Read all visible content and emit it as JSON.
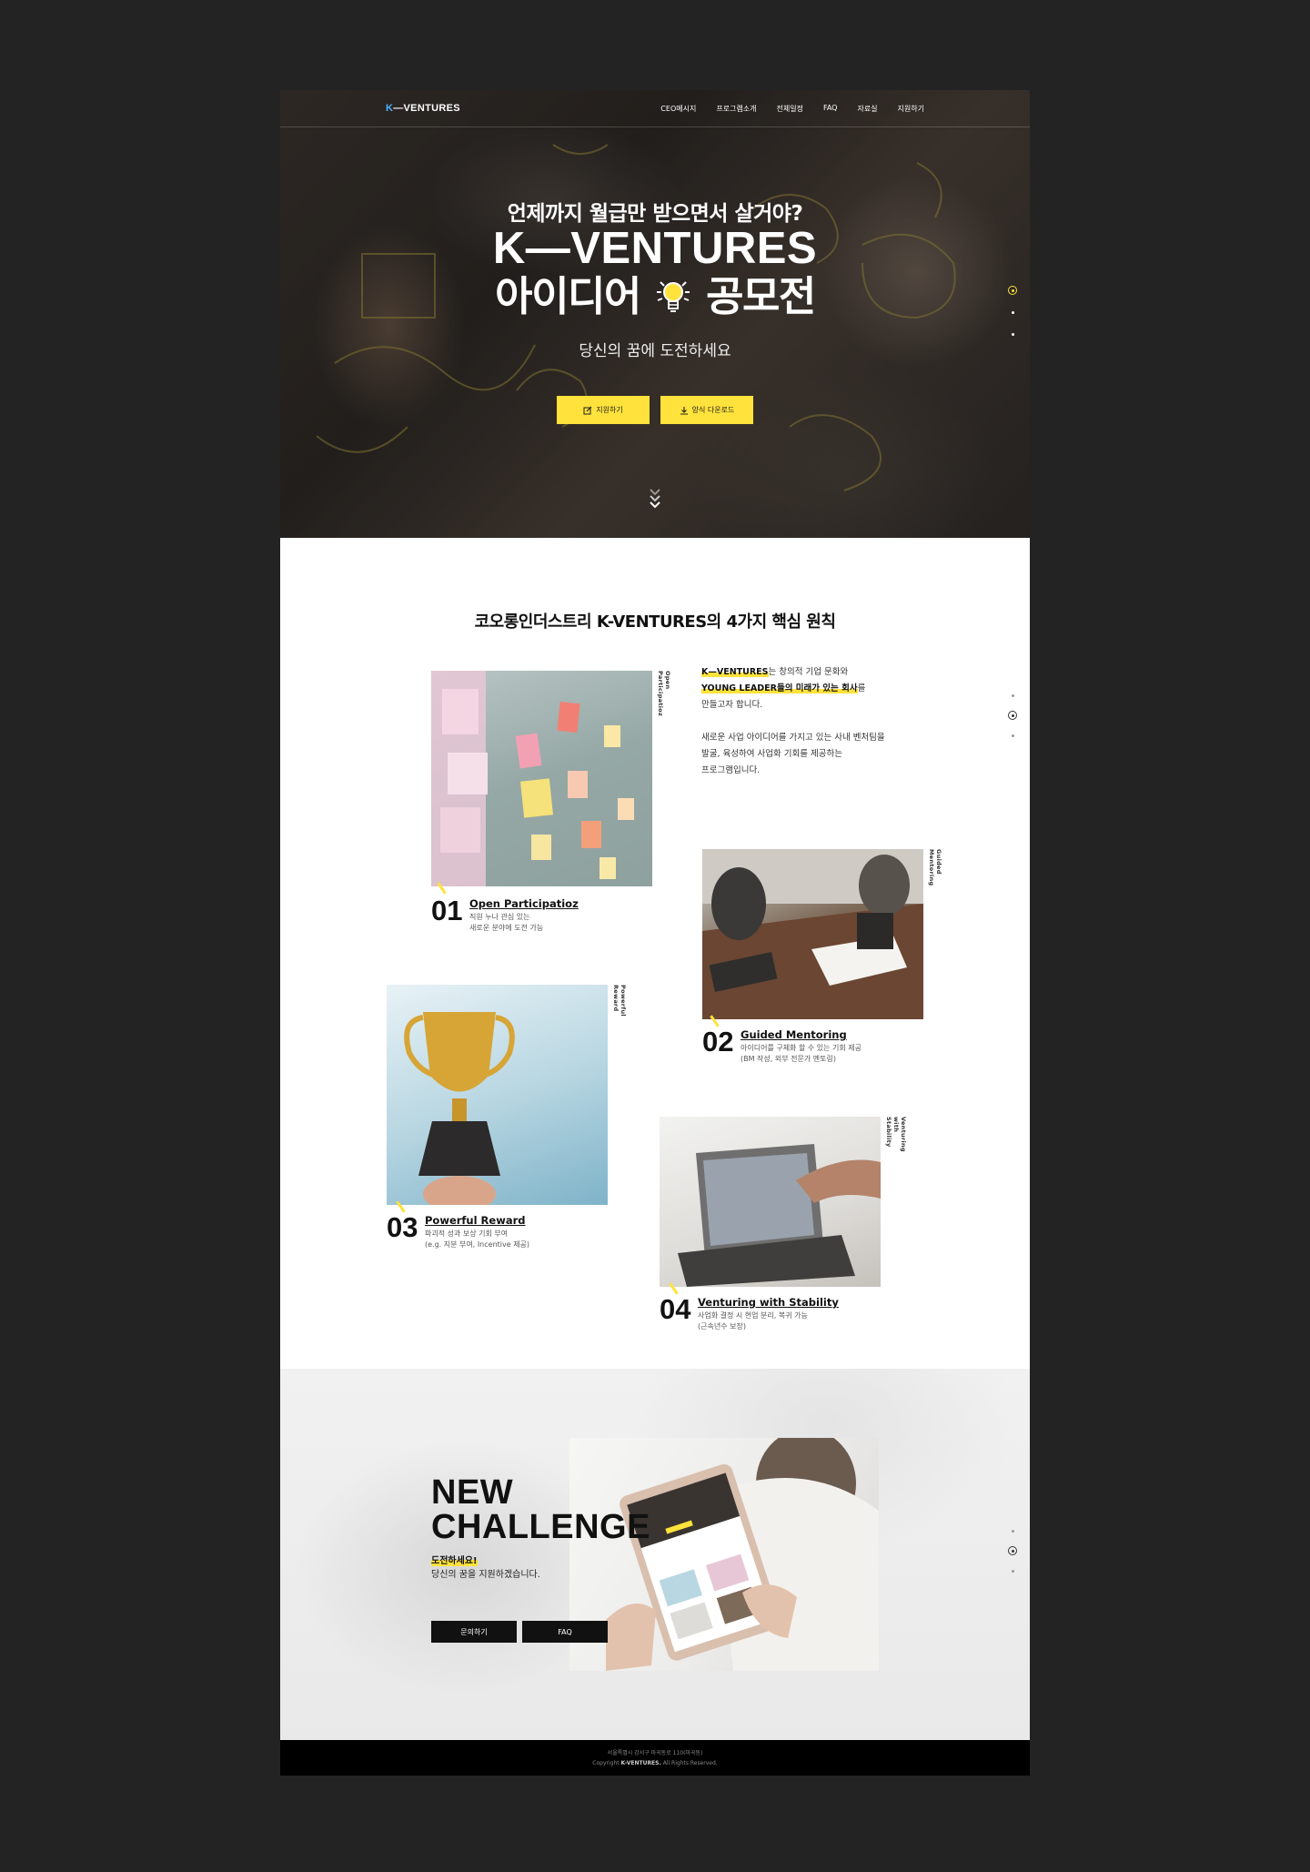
{
  "nav": {
    "logo_k": "K",
    "logo_rest": "—VENTURES",
    "items": [
      "CEO메시지",
      "프로그램소개",
      "전체일정",
      "FAQ",
      "자료실",
      "지원하기"
    ]
  },
  "hero": {
    "tagline": "언제까지 월급만 받으면서 살거야?",
    "brand": "K—VENTURES",
    "contest_left": "아이디어",
    "contest_right": "공모전",
    "subline": "당신의 꿈에 도전하세요",
    "apply_label": "지원하기",
    "download_label": "양식 다운로드"
  },
  "principles": {
    "title": "코오롱인더스트리 K-VENTURES의 4가지 핵심 원칙",
    "intro": {
      "brand": "K—VENTURES",
      "line1_rest": "는 창의적 기업 문화와",
      "line2_hl": "YOUNG LEADER들의 미래가 있는 회사",
      "line2_rest": "를",
      "line3": "만들고자 합니다.",
      "para2": "새로운 사업 아이디어를 가지고 있는 사내 벤처팀을\n발굴, 육성하여 사업화 기회를 제공하는\n프로그램입니다."
    },
    "cards": [
      {
        "num": "01",
        "name": "Open Participatioz",
        "vertical": "Open Participatioz",
        "desc1": "직원 누나 관심 있는",
        "desc2": "새로운 분야에 도전 가능"
      },
      {
        "num": "02",
        "name": "Guided Mentoring",
        "vertical": "Guided Mentoring",
        "desc1": "아이디어를 구체화 할 수 있는 기회 제공",
        "desc2": "(BM 작성, 외부 전문가 멘토링)"
      },
      {
        "num": "03",
        "name": "Powerful Reward",
        "vertical": "Powerful Reward",
        "desc1": "파괴적 성과 보상 기회 부여",
        "desc2": "(e.g. 지분 부여, Incentive 제공)"
      },
      {
        "num": "04",
        "name": "Venturing with Stability",
        "vertical": "Venturing with Stability",
        "desc1": "사업화 결정 시 현업 분리, 복귀 가능",
        "desc2": "(근속년수 보장)"
      }
    ]
  },
  "challenge": {
    "head1": "NEW",
    "head2": "CHALLENGE",
    "sub1": "도전하세요!",
    "sub2": "당신의 꿈을 지원하겠습니다.",
    "contact_label": "문의하기",
    "faq_label": "FAQ"
  },
  "footer": {
    "address": "서울특별시 강서구 마곡동로 110(마곡동)",
    "copy_prefix": "Copyright",
    "copy_brand": "K-VENTURES.",
    "copy_suffix": "All Rights Reserved."
  },
  "colors": {
    "accent": "#ffe23b",
    "dark_bg": "#232323",
    "logo_k": "#4fb0ff"
  },
  "icons": {
    "apply": "edit-icon",
    "download": "download-icon",
    "scroll": "chevron-down-icon",
    "bulb": "lightbulb-icon"
  }
}
